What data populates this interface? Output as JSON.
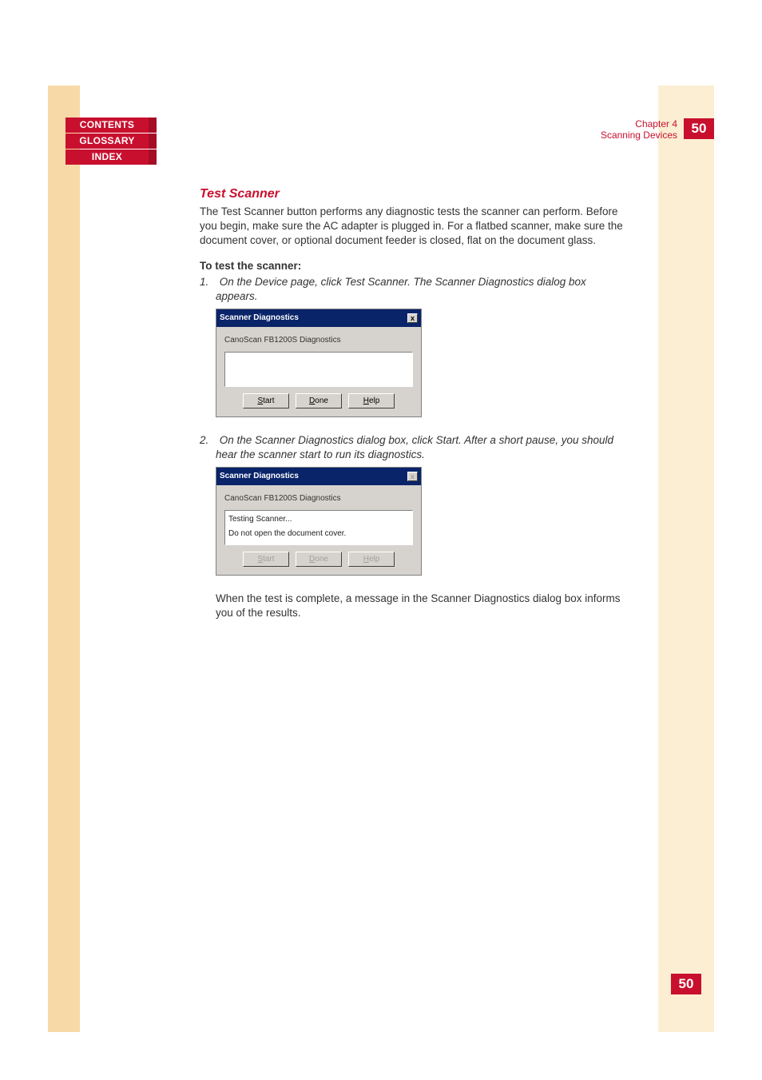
{
  "nav": {
    "contents": "CONTENTS",
    "glossary": "GLOSSARY",
    "index": "INDEX"
  },
  "header": {
    "chapter": "Chapter 4",
    "section": "Scanning Devices",
    "page": "50"
  },
  "heading": "Test Scanner",
  "intro": "The Test Scanner button performs any diagnostic tests the scanner can perform. Before you begin, make sure the AC adapter is plugged in. For a flatbed scanner, make sure the document cover, or optional document feeder is closed, flat on the document glass.",
  "subhead": "To test the scanner:",
  "step1": "1. On the Device page, click Test Scanner. The Scanner Diagnostics dialog box appears.",
  "step2": "2. On the Scanner Diagnostics dialog box, click Start. After a short pause, you should hear the scanner start to run its diagnostics.",
  "result": "When the test is complete, a message in the Scanner Diagnostics dialog box informs you of the results.",
  "dialog": {
    "title": "Scanner Diagnostics",
    "device": "CanoScan FB1200S Diagnostics",
    "close": "x",
    "status1": "",
    "status2_line1": "Testing Scanner...",
    "status2_line2": "Do not open the document cover.",
    "btn_start_s": "S",
    "btn_start_rest": "tart",
    "btn_done_d": "D",
    "btn_done_rest": "one",
    "btn_help_h": "H",
    "btn_help_rest": "elp"
  },
  "footer_page": "50"
}
